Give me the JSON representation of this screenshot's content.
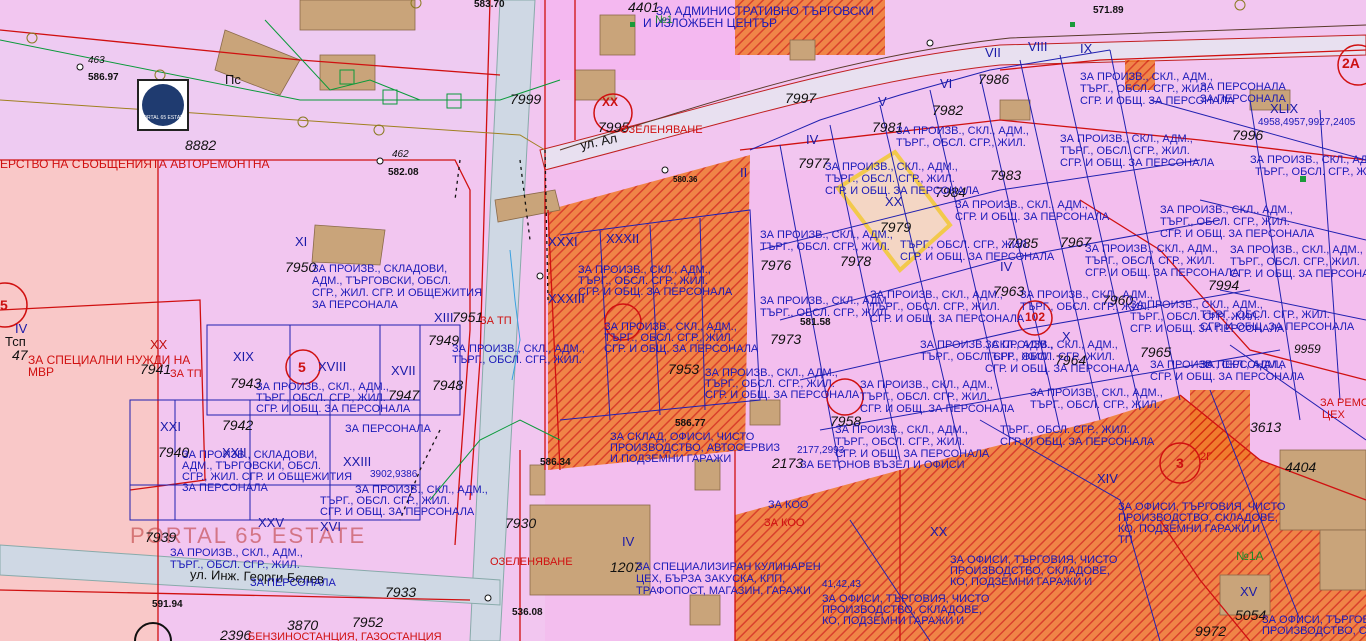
{
  "map": {
    "colors": {
      "background": "#f2c6f0",
      "road": "#cfd8e4",
      "parcel_line": "#2020b0",
      "regulation_line": "#d01010",
      "highlight": "#f2c94c",
      "hatch": "#e8410d"
    },
    "logo": {
      "icon": "house-logo-icon",
      "text": "PORTAL 65 ESTATE"
    },
    "streets": {
      "georgi_belev": "ул. Инж. Георги Белев",
      "ul_short": "ул. Ал"
    },
    "watermark": "PORTAL 65 ESTATE",
    "parcel_numbers": [
      "463",
      "8882",
      "462",
      "7950",
      "7941",
      "7943",
      "7942",
      "7940",
      "7939",
      "7933",
      "7930",
      "7999",
      "7997",
      "7995",
      "7981",
      "7977",
      "7982",
      "7986",
      "7983",
      "7985",
      "7984",
      "7979",
      "7978",
      "7976",
      "7973",
      "7963",
      "7967",
      "7965",
      "7964",
      "7960",
      "7996",
      "7994",
      "3613",
      "4404",
      "4401",
      "1207",
      "5054",
      "2396",
      "3870",
      "7952",
      "7949",
      "7948",
      "7947",
      "9959",
      "9972",
      "2173",
      "7958",
      "7951",
      "7953"
    ],
    "block_numbers": [
      "5",
      "XX",
      "XXI",
      "2A",
      "3",
      "102",
      "2",
      "XIII"
    ],
    "roman_labels": [
      "XI",
      "XII",
      "XIII",
      "XIV",
      "XV",
      "XVI",
      "XVII",
      "XVIII",
      "XIX",
      "XX",
      "XXI",
      "XXII",
      "XXIII",
      "XXIV",
      "XXV",
      "XXVI",
      "XXVII",
      "XXVIII",
      "XXIX",
      "XXX",
      "XXXI",
      "XXXII",
      "XXXIII",
      "I",
      "II",
      "III",
      "IV",
      "V",
      "VI",
      "VII",
      "VIII",
      "IX",
      "X",
      "XLIX"
    ],
    "elevations": [
      "586.97",
      "582.08",
      "583.70",
      "571.89",
      "580.36",
      "586.34",
      "591.94",
      "536.08",
      "586.77",
      "581.58"
    ],
    "texts": {
      "admin": "ЗА АДМИНИСТРАТИВНО ТЪРГОВСКИ",
      "admin_center": "И ИЗЛОЖБЕН ЦЕНТЪР",
      "ministry": "ЕРСТВО НА СЪОБЩЕНИЯТА АВТОРЕМОНТНА",
      "proizv": "ЗА ПРОИЗВ., СКЛАДОВИ,",
      "adm_targ": "АДМ., ТЪРГОВСКИ, ОБСЛ.",
      "sgr_obshtej": "СГР., ЖИЛ. СГР. И ОБЩЕЖИТИЯ",
      "personal": "ЗА ПЕРСОНАЛА",
      "special": "ЗА СПЕЦИАЛНИ НУЖДИ НА",
      "mvr": "МВР",
      "tp": "ЗА ТП",
      "proizv_skl": "ЗА ПРОИЗВ., СКЛ., АДМ.,",
      "targ_obsl": "ТЪРГ., ОБСЛ. СГР., ЖИЛ.",
      "sgr_obsht": "СГР. И ОБЩ. ЗА ПЕРСОНАЛА",
      "sklad_ofisi": "ЗА СКЛАД, ОФИСИ, ЧИСТО",
      "avtoserviz": "ПРОИЗВОДСТВО, АВТОСЕРВИЗ",
      "podzemni": "И ПОДЗЕМНИ ГАРАЖИ",
      "beton": "ЗА БЕТОНОВ ВЪЗЕЛ И ОФИСИ",
      "koo": "ЗА КОО",
      "kulinaren": "ЗА СПЕЦИАЛИЗИРАН КУЛИНАРЕН",
      "bar": "ЦЕХ, БЪРЗА ЗАКУСКА, КПП,",
      "trafopost": "ТРАФОПОСТ, МАГАЗИН, ГАРАЖИ",
      "ofisi_targ": "ЗА ОФИСИ, ТЪРГОВИЯ, ЧИСТО",
      "proizv_sklad": "ПРОИЗВОДСТВО, СКЛАДОВЕ,",
      "ko_podzemni": "КО, ПОДЗЕМНИ ГАРАЖИ И",
      "tp_short": "ТП",
      "remont": "ЗА РЕМОНТ",
      "ceh": "ЦЕХ",
      "ozelenyavane": "ОЗЕЛЕНЯВАНЕ",
      "benzin": "БЕНЗИНОСТАНЦИЯ, ГАЗОСТАНЦИЯ",
      "no1": "№1",
      "no1a": "№1А",
      "ps": "Пс",
      "tsp": "Тсп",
      "num47": "47",
      "multi1": "4958,4957,9927,2405",
      "multi2": "2177,2993",
      "multi3": "3902,9386",
      "multi4": "41,42,43",
      "g2": "2Г"
    }
  }
}
